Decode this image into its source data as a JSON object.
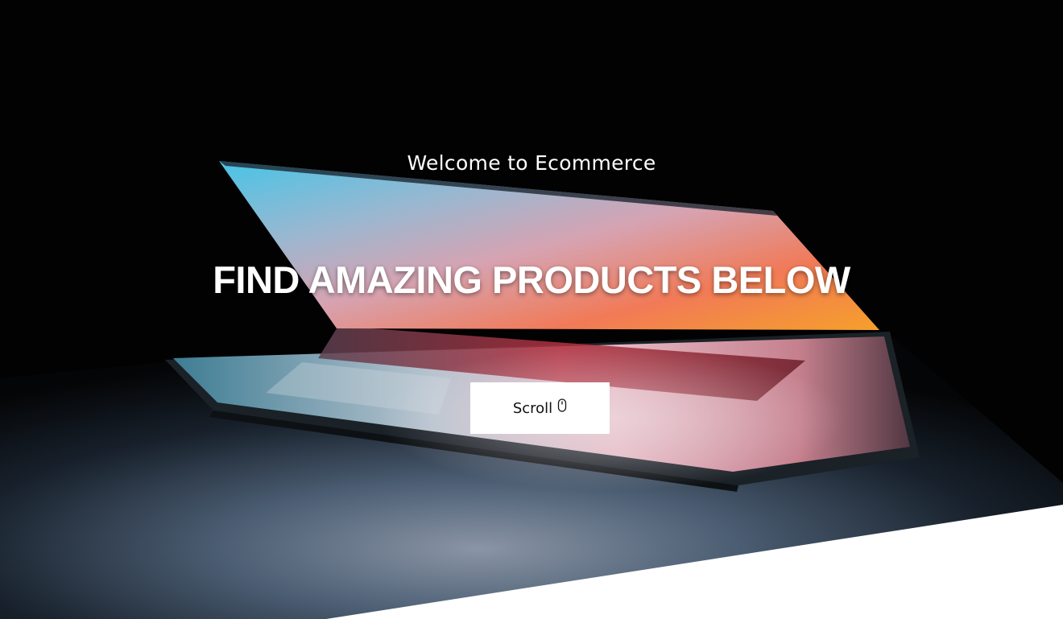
{
  "hero": {
    "welcome_text": "Welcome to Ecommerce",
    "headline": "FIND AMAZING PRODUCTS BELOW",
    "scroll_button": {
      "label": "Scroll",
      "icon": "mouse-icon"
    },
    "background_image": "laptop-opened-in-dark"
  },
  "colors": {
    "text": "#ffffff",
    "button_bg": "#ffffff",
    "button_text": "#111111",
    "background": "#020203"
  }
}
